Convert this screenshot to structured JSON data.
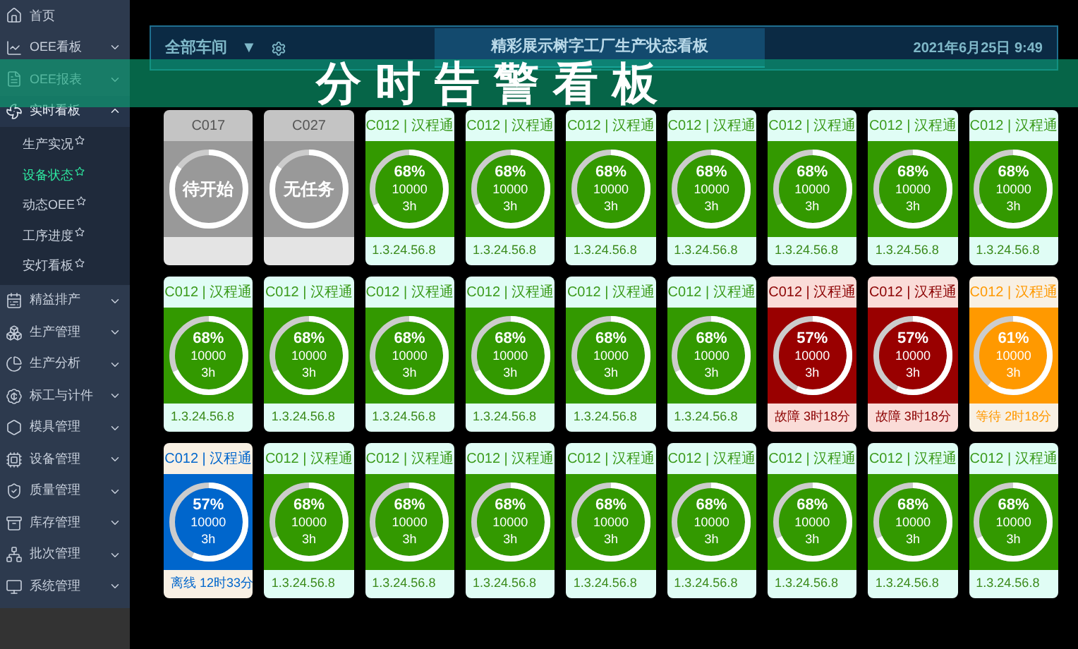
{
  "sidebar": {
    "items": [
      {
        "label": "首页",
        "has_caret": false,
        "expanded": false
      },
      {
        "label": "OEE看板",
        "has_caret": true,
        "expanded": false
      },
      {
        "label": "OEE报表",
        "has_caret": true,
        "expanded": false
      },
      {
        "label": "实时看板",
        "has_caret": true,
        "expanded": true,
        "children": [
          {
            "label": "生产实况",
            "selected": false
          },
          {
            "label": "设备状态",
            "selected": true
          },
          {
            "label": "动态OEE",
            "selected": false
          },
          {
            "label": "工序进度",
            "selected": false
          },
          {
            "label": "安灯看板",
            "selected": false
          }
        ]
      },
      {
        "label": "精益排产",
        "has_caret": true,
        "expanded": false
      },
      {
        "label": "生产管理",
        "has_caret": true,
        "expanded": false
      },
      {
        "label": "生产分析",
        "has_caret": true,
        "expanded": false
      },
      {
        "label": "标工与计件",
        "has_caret": true,
        "expanded": false
      },
      {
        "label": "模具管理",
        "has_caret": true,
        "expanded": false
      },
      {
        "label": "设备管理",
        "has_caret": true,
        "expanded": false
      },
      {
        "label": "质量管理",
        "has_caret": true,
        "expanded": false
      },
      {
        "label": "库存管理",
        "has_caret": true,
        "expanded": false
      },
      {
        "label": "批次管理",
        "has_caret": true,
        "expanded": false
      },
      {
        "label": "系统管理",
        "has_caret": true,
        "expanded": false
      }
    ]
  },
  "header": {
    "workshop": "全部车间",
    "dropdown": "▼",
    "title": "精彩展示树字工厂生产状态看板",
    "datetime": "2021年6月25日 9:49"
  },
  "banner": {
    "title": "分时告警看板"
  },
  "cards": [
    {
      "kind": "idle",
      "header": "C017",
      "label": "待开始",
      "level": 0.85
    },
    {
      "kind": "idle",
      "header": "C027",
      "label": "无任务",
      "level": 0.85
    },
    {
      "kind": "running",
      "header": "C012 | 汉程通",
      "percent": "68%",
      "count": "10000",
      "hours": "3h",
      "footer": "1.3.24.56.8",
      "level": 0.68
    },
    {
      "kind": "running",
      "header": "C012 | 汉程通",
      "percent": "68%",
      "count": "10000",
      "hours": "3h",
      "footer": "1.3.24.56.8",
      "level": 0.68
    },
    {
      "kind": "running",
      "header": "C012 | 汉程通",
      "percent": "68%",
      "count": "10000",
      "hours": "3h",
      "footer": "1.3.24.56.8",
      "level": 0.68
    },
    {
      "kind": "running",
      "header": "C012 | 汉程通",
      "percent": "68%",
      "count": "10000",
      "hours": "3h",
      "footer": "1.3.24.56.8",
      "level": 0.68
    },
    {
      "kind": "running",
      "header": "C012 | 汉程通",
      "percent": "68%",
      "count": "10000",
      "hours": "3h",
      "footer": "1.3.24.56.8",
      "level": 0.68
    },
    {
      "kind": "running",
      "header": "C012 | 汉程通",
      "percent": "68%",
      "count": "10000",
      "hours": "3h",
      "footer": "1.3.24.56.8",
      "level": 0.68
    },
    {
      "kind": "running",
      "header": "C012 | 汉程通",
      "percent": "68%",
      "count": "10000",
      "hours": "3h",
      "footer": "1.3.24.56.8",
      "level": 0.68
    },
    {
      "kind": "running",
      "header": "C012 | 汉程通",
      "percent": "68%",
      "count": "10000",
      "hours": "3h",
      "footer": "1.3.24.56.8",
      "level": 0.68
    },
    {
      "kind": "running",
      "header": "C012 | 汉程通",
      "percent": "68%",
      "count": "10000",
      "hours": "3h",
      "footer": "1.3.24.56.8",
      "level": 0.68
    },
    {
      "kind": "running",
      "header": "C012 | 汉程通",
      "percent": "68%",
      "count": "10000",
      "hours": "3h",
      "footer": "1.3.24.56.8",
      "level": 0.68
    },
    {
      "kind": "running",
      "header": "C012 | 汉程通",
      "percent": "68%",
      "count": "10000",
      "hours": "3h",
      "footer": "1.3.24.56.8",
      "level": 0.68
    },
    {
      "kind": "running",
      "header": "C012 | 汉程通",
      "percent": "68%",
      "count": "10000",
      "hours": "3h",
      "footer": "1.3.24.56.8",
      "level": 0.68
    },
    {
      "kind": "running",
      "header": "C012 | 汉程通",
      "percent": "68%",
      "count": "10000",
      "hours": "3h",
      "footer": "1.3.24.56.8",
      "level": 0.68
    },
    {
      "kind": "fault",
      "header": "C012 | 汉程通",
      "percent": "57%",
      "count": "10000",
      "hours": "3h",
      "footer": "故障 3时18分",
      "level": 0.57
    },
    {
      "kind": "fault",
      "header": "C012 | 汉程通",
      "percent": "57%",
      "count": "10000",
      "hours": "3h",
      "footer": "故障 3时18分",
      "level": 0.57
    },
    {
      "kind": "waiting",
      "header": "C012 | 汉程通",
      "percent": "61%",
      "count": "10000",
      "hours": "3h",
      "footer": "等待 2时18分",
      "level": 0.61
    },
    {
      "kind": "offline",
      "header": "C012 | 汉程通",
      "percent": "57%",
      "count": "10000",
      "hours": "3h",
      "footer": "离线 12时33分",
      "level": 0.57
    },
    {
      "kind": "running",
      "header": "C012 | 汉程通",
      "percent": "68%",
      "count": "10000",
      "hours": "3h",
      "footer": "1.3.24.56.8",
      "level": 0.68
    },
    {
      "kind": "running",
      "header": "C012 | 汉程通",
      "percent": "68%",
      "count": "10000",
      "hours": "3h",
      "footer": "1.3.24.56.8",
      "level": 0.68
    },
    {
      "kind": "running",
      "header": "C012 | 汉程通",
      "percent": "68%",
      "count": "10000",
      "hours": "3h",
      "footer": "1.3.24.56.8",
      "level": 0.68
    },
    {
      "kind": "running",
      "header": "C012 | 汉程通",
      "percent": "68%",
      "count": "10000",
      "hours": "3h",
      "footer": "1.3.24.56.8",
      "level": 0.68
    },
    {
      "kind": "running",
      "header": "C012 | 汉程通",
      "percent": "68%",
      "count": "10000",
      "hours": "3h",
      "footer": "1.3.24.56.8",
      "level": 0.68
    },
    {
      "kind": "running",
      "header": "C012 | 汉程通",
      "percent": "68%",
      "count": "10000",
      "hours": "3h",
      "footer": "1.3.24.56.8",
      "level": 0.68
    },
    {
      "kind": "running",
      "header": "C012 | 汉程通",
      "percent": "68%",
      "count": "10000",
      "hours": "3h",
      "footer": "1.3.24.56.8",
      "level": 0.68
    },
    {
      "kind": "running",
      "header": "C012 | 汉程通",
      "percent": "68%",
      "count": "10000",
      "hours": "3h",
      "footer": "1.3.24.56.8",
      "level": 0.68
    }
  ]
}
